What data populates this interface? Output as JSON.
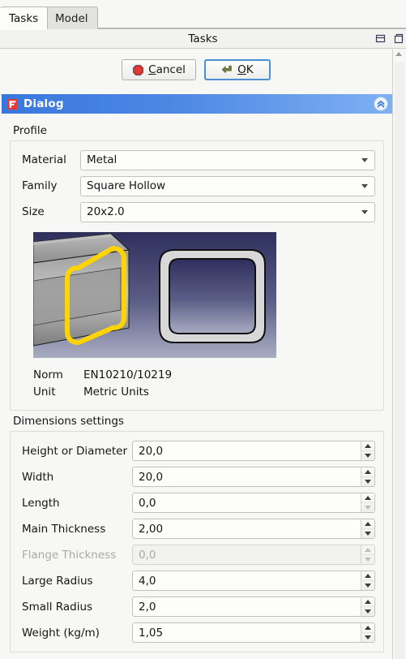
{
  "tabs": [
    {
      "label": "Tasks",
      "active": true
    },
    {
      "label": "Model",
      "active": false
    }
  ],
  "panel": {
    "title": "Tasks",
    "buttons": [
      {
        "name": "panel-undock-button",
        "icon": "split-panel-icon"
      },
      {
        "name": "panel-float-button",
        "icon": "float-panel-icon"
      }
    ]
  },
  "actions": {
    "cancel_label": "Cancel",
    "cancel_accel": "C",
    "ok_label": "OK",
    "ok_accel": "O"
  },
  "dialog": {
    "title": "Dialog",
    "logo": "freecad-logo-icon",
    "collapse_icon": "double-chevron-up-icon",
    "header_gradient_from": "#3a77dc",
    "header_gradient_to": "#7fb0f2"
  },
  "profile": {
    "group_label": "Profile",
    "fields": [
      {
        "label": "Material",
        "value": "Metal"
      },
      {
        "label": "Family",
        "value": "Square Hollow"
      },
      {
        "label": "Size",
        "value": "20x2.0"
      }
    ],
    "preview": {
      "name": "profile-preview-image",
      "bg_top": "#2e2f5c",
      "bg_bottom": "#a3a7bd",
      "highlight_color": "#ffd400",
      "section_color": "#d6d6d6"
    },
    "info": [
      {
        "key": "Norm",
        "value": "EN10210/10219"
      },
      {
        "key": "Unit",
        "value": "Metric Units"
      }
    ]
  },
  "dimensions": {
    "group_label": "Dimensions settings",
    "rows": [
      {
        "label": "Height or Diameter",
        "value": "20,0",
        "disabled": false,
        "down_disabled": false
      },
      {
        "label": "Width",
        "value": "20,0",
        "disabled": false,
        "down_disabled": false
      },
      {
        "label": "Length",
        "value": "0,0",
        "disabled": false,
        "down_disabled": true
      },
      {
        "label": "Main Thickness",
        "value": "2,00",
        "disabled": false,
        "down_disabled": false
      },
      {
        "label": "Flange Thickness",
        "value": "0,0",
        "disabled": true,
        "down_disabled": true
      },
      {
        "label": "Large Radius",
        "value": "4,0",
        "disabled": false,
        "down_disabled": false
      },
      {
        "label": "Small Radius",
        "value": "2,0",
        "disabled": false,
        "down_disabled": false
      },
      {
        "label": "Weight (kg/m)",
        "value": "1,05",
        "disabled": false,
        "down_disabled": false
      }
    ]
  }
}
